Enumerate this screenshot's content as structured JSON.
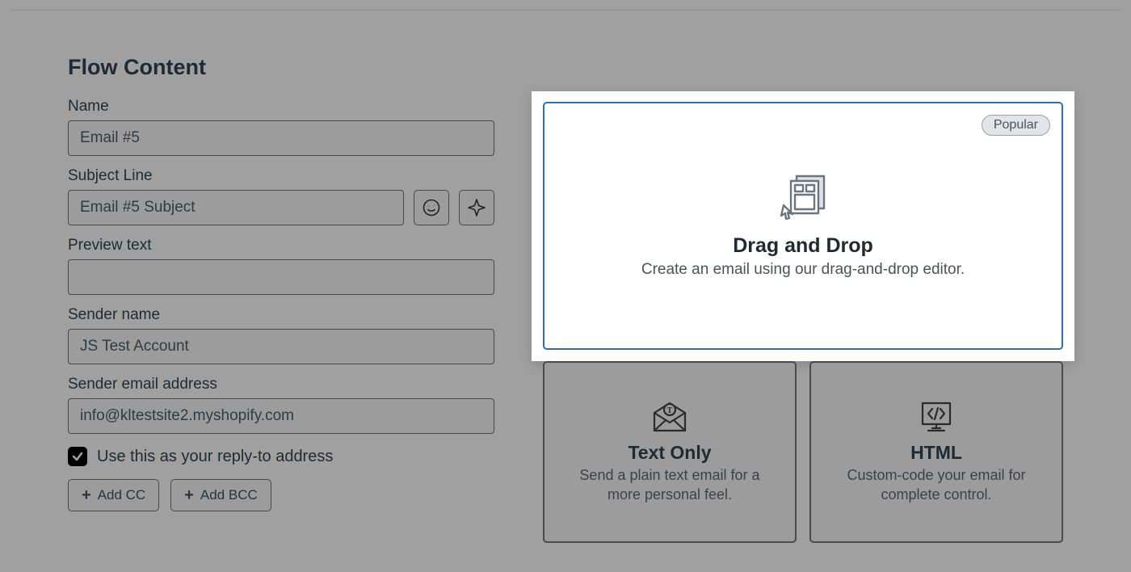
{
  "heading": "Flow Content",
  "fields": {
    "name": {
      "label": "Name",
      "value": "Email #5"
    },
    "subject": {
      "label": "Subject Line",
      "value": "Email #5 Subject"
    },
    "preview": {
      "label": "Preview text",
      "value": ""
    },
    "sender_name": {
      "label": "Sender name",
      "value": "JS Test Account"
    },
    "sender_email": {
      "label": "Sender email address",
      "value": "info@kltestsite2.myshopify.com"
    }
  },
  "reply_to_checkbox": {
    "checked": true,
    "label": "Use this as your reply-to address"
  },
  "buttons": {
    "add_cc": "Add CC",
    "add_bcc": "Add BCC"
  },
  "editors": {
    "drag_drop": {
      "badge": "Popular",
      "title": "Drag and Drop",
      "desc": "Create an email using our drag-and-drop editor."
    },
    "text_only": {
      "title": "Text Only",
      "desc": "Send a plain text email for a more personal feel."
    },
    "html": {
      "title": "HTML",
      "desc": "Custom-code your email for complete control."
    }
  }
}
